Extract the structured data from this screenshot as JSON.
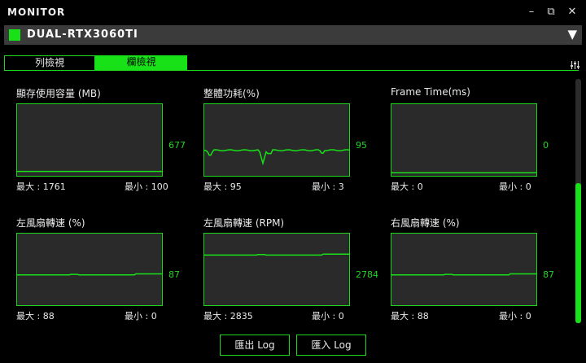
{
  "window": {
    "title": "MONITOR",
    "minimize": "–",
    "restore": "⧉",
    "close": "✕"
  },
  "device": {
    "name": "DUAL-RTX3060TI",
    "dropdown_arrow": "▼",
    "accent": "#18e118"
  },
  "tabs": [
    {
      "label": "列檢視",
      "active": false
    },
    {
      "label": "欄檢視",
      "active": true
    }
  ],
  "panels": [
    {
      "title": "顯存使用容量 (MB)",
      "current": "677",
      "max_label": "最大 : 1761",
      "min_label": "最小 : 100",
      "level": 0.04,
      "trend": "flat"
    },
    {
      "title": "整體功耗(%)",
      "current": "95",
      "max_label": "最大 : 95",
      "min_label": "最小 : 3",
      "level": 0.35,
      "trend": "spiky"
    },
    {
      "title": "Frame Time(ms)",
      "current": "0",
      "max_label": "最大 : 0",
      "min_label": "最小 : 0",
      "level": 0.02,
      "trend": "flat"
    },
    {
      "title": "左風扇轉速 (%)",
      "current": "87",
      "max_label": "最大 : 88",
      "min_label": "最小 : 0",
      "level": 0.42,
      "trend": "step"
    },
    {
      "title": "左風扇轉速 (RPM)",
      "current": "2784",
      "max_label": "最大 : 2835",
      "min_label": "最小 : 0",
      "level": 0.71,
      "trend": "step"
    },
    {
      "title": "右風扇轉速 (%)",
      "current": "87",
      "max_label": "最大 : 88",
      "min_label": "最小 : 0",
      "level": 0.42,
      "trend": "step"
    }
  ],
  "buttons": {
    "export": "匯出 Log",
    "import": "匯入 Log"
  }
}
